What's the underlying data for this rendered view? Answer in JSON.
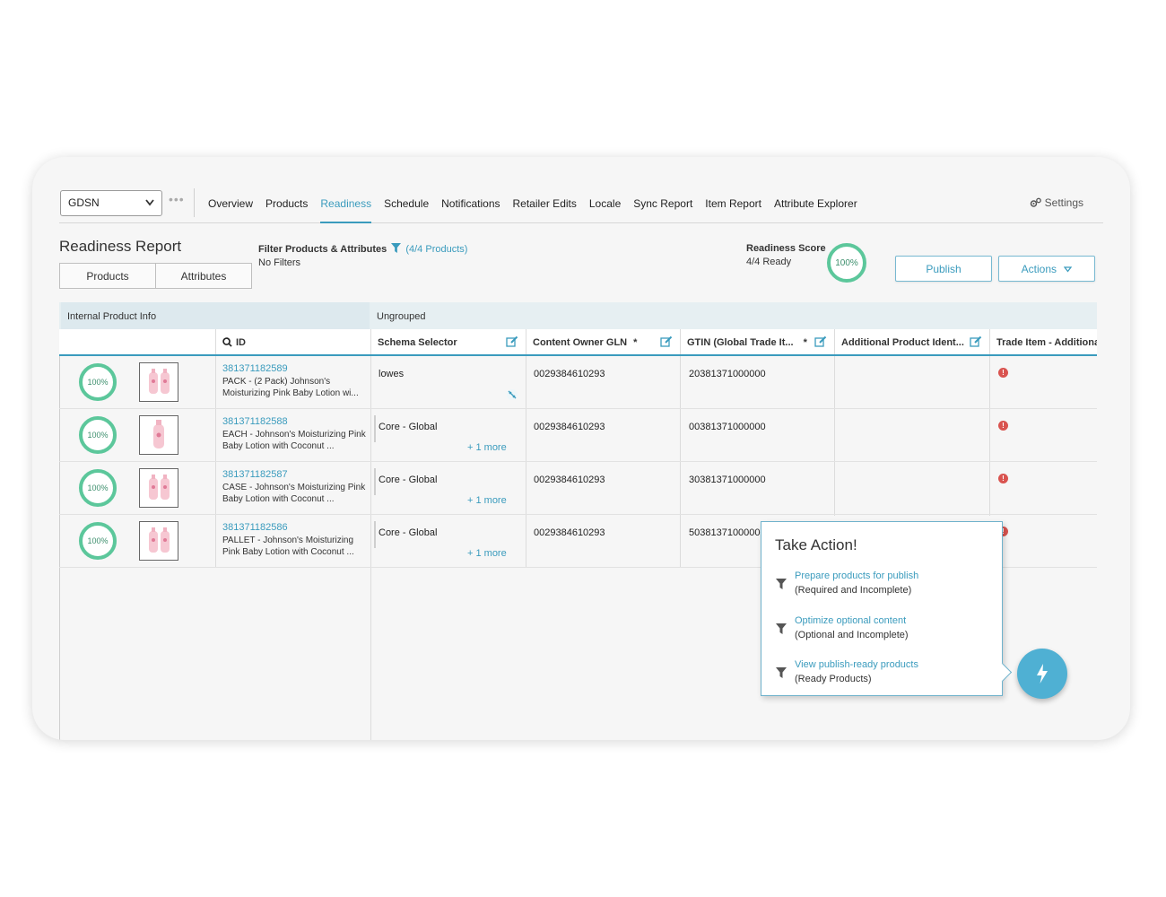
{
  "nav": {
    "catalog_select": "GDSN",
    "more_dots": "•••",
    "tabs": [
      "Overview",
      "Products",
      "Readiness",
      "Schedule",
      "Notifications",
      "Retailer Edits",
      "Locale",
      "Sync Report",
      "Item Report",
      "Attribute Explorer"
    ],
    "active_tab": "Readiness",
    "settings_label": "Settings"
  },
  "report": {
    "title": "Readiness Report",
    "view_toggle": [
      "Products",
      "Attributes"
    ],
    "filter_title": "Filter Products & Attributes",
    "filter_count": "(4/4 Products)",
    "filter_state": "No Filters",
    "score_label": "Readiness Score",
    "score_sub": "4/4 Ready",
    "score_value": "100%",
    "publish_label": "Publish",
    "actions_label": "Actions"
  },
  "table": {
    "group_left": "Internal Product Info",
    "group_right": "Ungrouped",
    "columns": {
      "id": "ID",
      "schema": "Schema Selector",
      "gln": "Content Owner GLN",
      "gtin": "GTIN (Global Trade It...",
      "additional": "Additional Product Ident...",
      "trade": "Trade Item - Additional"
    },
    "required_mark": "*",
    "rows": [
      {
        "score": "100%",
        "id": "381371182589",
        "desc": "PACK - (2 Pack) Johnson's Moisturizing Pink Baby Lotion wi...",
        "schema": "lowes",
        "more": "",
        "gln": "0029384610293",
        "gtin": "20381371000000",
        "error": "!"
      },
      {
        "score": "100%",
        "id": "381371182588",
        "desc": "EACH - Johnson's Moisturizing Pink Baby Lotion with Coconut ...",
        "schema": "Core - Global",
        "more": "+ 1 more",
        "gln": "0029384610293",
        "gtin": "00381371000000",
        "error": "!"
      },
      {
        "score": "100%",
        "id": "381371182587",
        "desc": "CASE - Johnson's Moisturizing Pink Baby Lotion with Coconut ...",
        "schema": "Core - Global",
        "more": "+ 1 more",
        "gln": "0029384610293",
        "gtin": "30381371000000",
        "error": "!"
      },
      {
        "score": "100%",
        "id": "381371182586",
        "desc": "PALLET - Johnson's Moisturizing Pink Baby Lotion with Coconut ...",
        "schema": "Core - Global",
        "more": "+ 1 more",
        "gln": "0029384610293",
        "gtin": "50381371000000",
        "error": "!"
      }
    ]
  },
  "take_action": {
    "title": "Take Action!",
    "items": [
      {
        "link": "Prepare products for publish",
        "sub": "(Required and Incomplete)"
      },
      {
        "link": "Optimize optional content",
        "sub": "(Optional and Incomplete)"
      },
      {
        "link": "View publish-ready products",
        "sub": "(Ready Products)"
      }
    ]
  },
  "colors": {
    "accent": "#3a9bbd",
    "ready_ring": "#5cc79b",
    "error": "#d9534f",
    "fab": "#4fb0d3"
  }
}
